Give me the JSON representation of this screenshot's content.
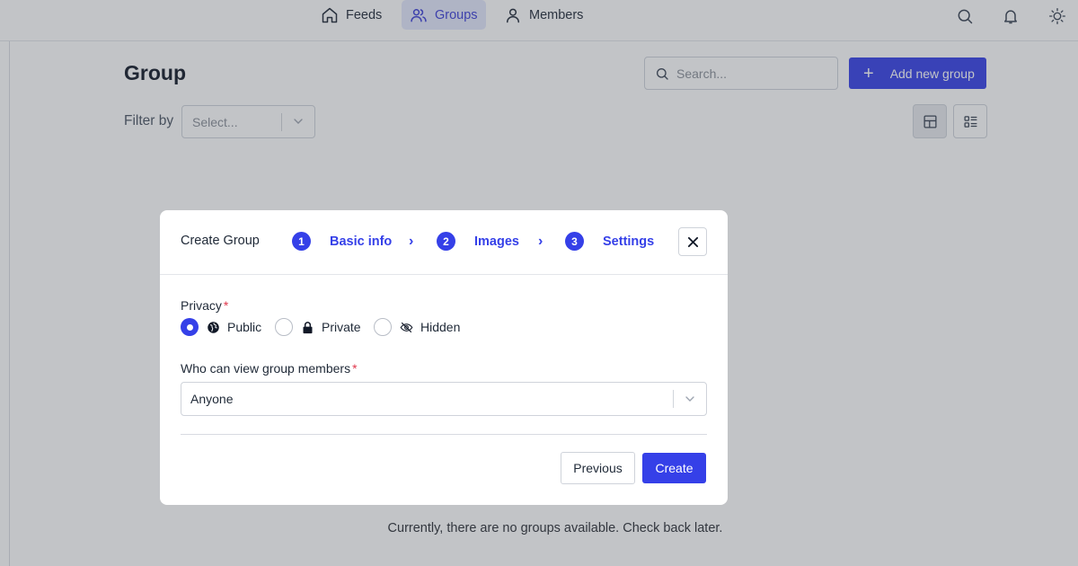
{
  "nav": {
    "items": [
      {
        "label": "Feeds",
        "icon": "home-icon",
        "active": false
      },
      {
        "label": "Groups",
        "icon": "users-icon",
        "active": true
      },
      {
        "label": "Members",
        "icon": "user-icon",
        "active": false
      }
    ],
    "right_icons": [
      "search-icon",
      "bell-icon",
      "sun-icon"
    ]
  },
  "page": {
    "title": "Group",
    "search_placeholder": "Search...",
    "add_button_label": "Add new group",
    "filter_label": "Filter by",
    "filter_placeholder": "Select...",
    "view_modes": [
      "grid-view-icon",
      "list-view-icon"
    ],
    "active_view": "grid",
    "empty_message": "Currently, there are no groups available. Check back later."
  },
  "modal": {
    "title": "Create Group",
    "steps": [
      {
        "number": "1",
        "label": "Basic info"
      },
      {
        "number": "2",
        "label": "Images"
      },
      {
        "number": "3",
        "label": "Settings"
      }
    ],
    "step_separator": "›",
    "privacy": {
      "label": "Privacy",
      "required_mark": "*",
      "options": [
        {
          "label": "Public",
          "icon": "globe-icon",
          "selected": true
        },
        {
          "label": "Private",
          "icon": "lock-icon",
          "selected": false
        },
        {
          "label": "Hidden",
          "icon": "eye-off-icon",
          "selected": false
        }
      ]
    },
    "members_visibility": {
      "label": "Who can view group members",
      "required_mark": "*",
      "value": "Anyone"
    },
    "previous_label": "Previous",
    "create_label": "Create"
  },
  "colors": {
    "accent": "#3540e8",
    "required": "#e0364b",
    "overlay": "rgba(65,70,82,0.32)"
  }
}
